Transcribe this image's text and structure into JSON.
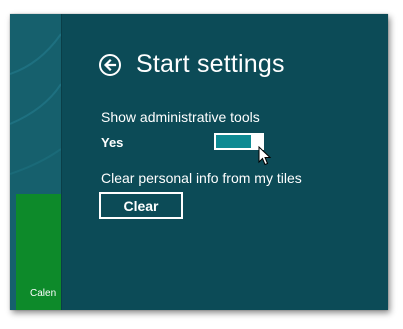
{
  "start_tile": {
    "label": "Calen",
    "color": "#0d8a2a"
  },
  "settings": {
    "title": "Start settings",
    "back_icon": "back-arrow-circle-icon",
    "admin_tools": {
      "label": "Show administrative tools",
      "value": "Yes",
      "on": true
    },
    "clear_info": {
      "label": "Clear personal info from my tiles",
      "button_label": "Clear"
    }
  },
  "colors": {
    "pane_background": "#0c4b57",
    "toggle_on": "#0e8a93",
    "tile": "#0d8a2a"
  }
}
